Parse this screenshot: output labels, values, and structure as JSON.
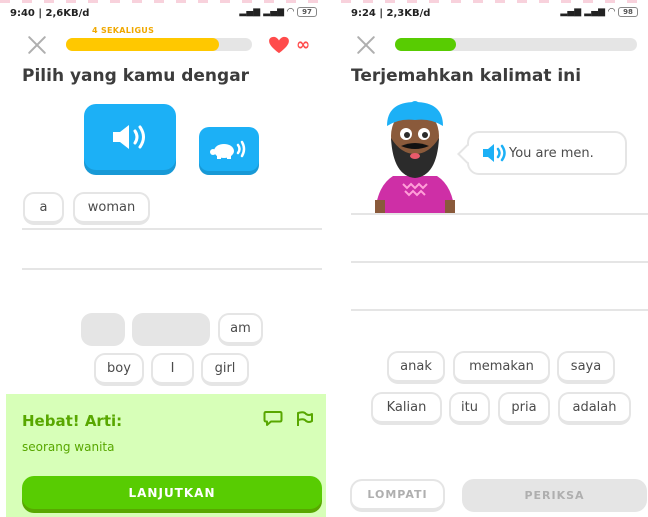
{
  "left": {
    "status": {
      "time": "9:40 | 2,6KB/d",
      "battery": "97"
    },
    "streak_label": "4 SEKALIGUS",
    "progress": 0.82,
    "accent": "#ffc800",
    "infinity": "∞",
    "title": "Pilih yang kamu dengar",
    "answer_chips": [
      "a",
      "woman"
    ],
    "word_bank": [
      "am",
      "boy",
      "I",
      "girl"
    ],
    "feedback": {
      "title": "Hebat! Arti:",
      "translation": "seorang wanita",
      "continue_label": "LANJUTKAN",
      "bg": "#d7ffb8"
    }
  },
  "right": {
    "status": {
      "time": "9:24 | 2,3KB/d",
      "battery": "98"
    },
    "progress": 0.25,
    "accent": "#58cc02",
    "title": "Terjemahkan kalimat ini",
    "prompt": "You are men.",
    "word_bank_row1": [
      "anak",
      "memakan",
      "saya"
    ],
    "word_bank_row2": [
      "Kalian",
      "itu",
      "pria",
      "adalah"
    ],
    "skip_label": "LOMPATI",
    "check_label": "PERIKSA"
  }
}
